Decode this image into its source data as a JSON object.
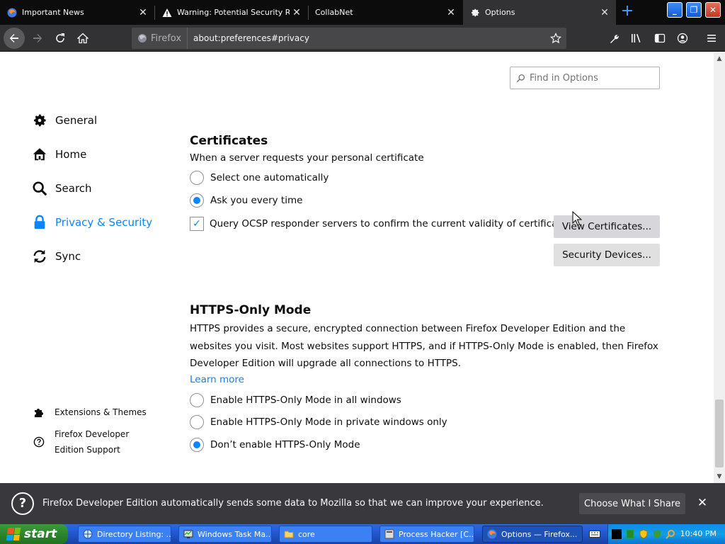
{
  "tabs": [
    {
      "label": "Important News",
      "icon": "firefox-icon",
      "active": false
    },
    {
      "label": "Warning: Potential Security Risk",
      "icon": "warning-icon",
      "active": false
    },
    {
      "label": "CollabNet",
      "icon": "none",
      "active": false
    },
    {
      "label": "Options",
      "icon": "gear-icon",
      "active": true
    }
  ],
  "navbar": {
    "identity_label": "Firefox",
    "url": "about:preferences#privacy"
  },
  "search": {
    "placeholder": "Find in Options"
  },
  "sidebar": {
    "items": [
      {
        "label": "General",
        "icon": "gear-icon"
      },
      {
        "label": "Home",
        "icon": "home-icon"
      },
      {
        "label": "Search",
        "icon": "search-icon"
      },
      {
        "label": "Privacy & Security",
        "icon": "lock-icon",
        "selected": true
      },
      {
        "label": "Sync",
        "icon": "sync-icon"
      }
    ],
    "footer": [
      {
        "label": "Extensions & Themes",
        "icon": "puzzle-icon"
      },
      {
        "label": "Firefox Developer Edition Support",
        "icon": "help-icon"
      }
    ]
  },
  "certificates": {
    "title": "Certificates",
    "subtitle": "When a server requests your personal certificate",
    "options": [
      {
        "label": "Select one automatically",
        "checked": false
      },
      {
        "label": "Ask you every time",
        "checked": true
      }
    ],
    "ocsp_label": "Query OCSP responder servers to confirm the current validity of certificates",
    "ocsp_checked": true,
    "view_button": "View Certificates...",
    "devices_button": "Security Devices..."
  },
  "https": {
    "title": "HTTPS-Only Mode",
    "description": "HTTPS provides a secure, encrypted connection between Firefox Developer Edition and the websites you visit. Most websites support HTTPS, and if HTTPS-Only Mode is enabled, then Firefox Developer Edition will upgrade all connections to HTTPS.",
    "learn_more": "Learn more",
    "options": [
      {
        "label": "Enable HTTPS-Only Mode in all windows",
        "checked": false
      },
      {
        "label": "Enable HTTPS-Only Mode in private windows only",
        "checked": false
      },
      {
        "label": "Don’t enable HTTPS-Only Mode",
        "checked": true
      }
    ]
  },
  "notification": {
    "text": "Firefox Developer Edition automatically sends some data to Mozilla so that we can improve your experience.",
    "button": "Choose What I Share"
  },
  "taskbar": {
    "start_label": "start",
    "tasks": [
      {
        "label": "Directory Listing: ...",
        "icon": "browser-icon",
        "active": false
      },
      {
        "label": "Windows Task Ma...",
        "icon": "task-manager-icon",
        "active": false
      },
      {
        "label": "core",
        "icon": "folder-icon",
        "active": false
      },
      {
        "label": "Process Hacker [C...",
        "icon": "process-hacker-icon",
        "active": false
      },
      {
        "label": "Options — Firefox...",
        "icon": "firefox-icon",
        "active": true
      }
    ],
    "clock": "10:40 PM"
  },
  "colors": {
    "accent": "#0a84ff",
    "tabbar_bg": "#0c0c0d",
    "toolbar_bg": "#323234",
    "notification_bg": "#38383d"
  }
}
